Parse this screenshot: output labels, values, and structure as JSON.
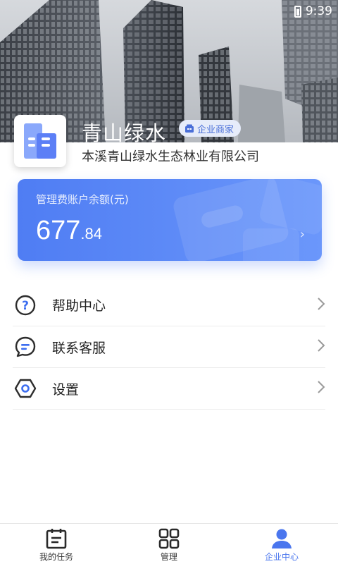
{
  "status_bar": {
    "time": "9:39"
  },
  "company": {
    "short_name": "青山绿水",
    "badge": "企业商家",
    "full_name": "本溪青山绿水生态林业有限公司"
  },
  "balance_card": {
    "label": "管理费账户余额(元)",
    "integer": "677",
    "decimal": ".84",
    "arrow": "›"
  },
  "menu": [
    {
      "label": "帮助中心",
      "icon": "help-icon"
    },
    {
      "label": "联系客服",
      "icon": "chat-icon"
    },
    {
      "label": "设置",
      "icon": "settings-icon"
    }
  ],
  "tabs": [
    {
      "label": "我的任务",
      "icon": "calendar-icon",
      "active": false
    },
    {
      "label": "管理",
      "icon": "grid-icon",
      "active": false
    },
    {
      "label": "企业中心",
      "icon": "user-icon",
      "active": true
    }
  ],
  "colors": {
    "accent": "#4a76ee",
    "card_start": "#4f7df3",
    "card_end": "#6b97fb",
    "text": "#222222"
  }
}
